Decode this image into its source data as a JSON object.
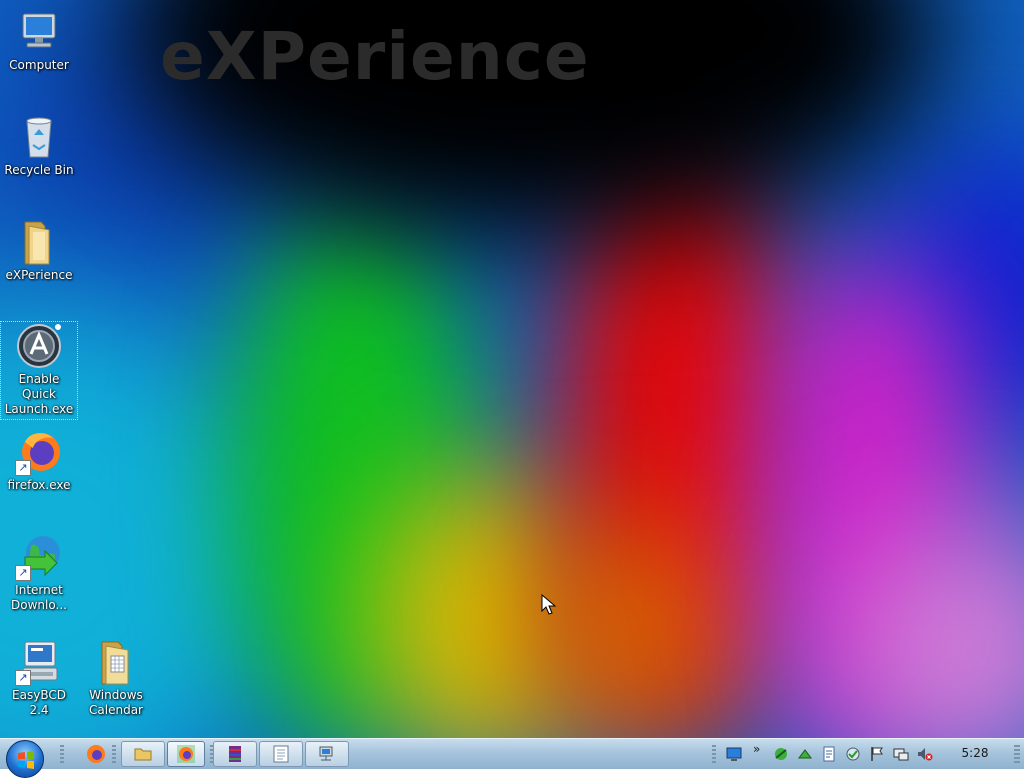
{
  "desktop": {
    "brand_text": "eXPerience",
    "icons": [
      {
        "name": "computer",
        "label": "Computer"
      },
      {
        "name": "recycle-bin",
        "label": "Recycle Bin"
      },
      {
        "name": "experience-folder",
        "label": "eXPerience"
      },
      {
        "name": "enable-quick-launch",
        "label": "Enable Quick Launch.exe",
        "selected": true
      },
      {
        "name": "firefox",
        "label": "firefox.exe"
      },
      {
        "name": "internet-download-manager",
        "label": "Internet Downlo..."
      },
      {
        "name": "easybcd",
        "label": "EasyBCD 2.4"
      },
      {
        "name": "windows-calendar",
        "label": "Windows Calendar"
      }
    ]
  },
  "taskbar": {
    "start_icon": "windows-orb-icon",
    "quick_launch": [
      {
        "name": "firefox-quicklaunch",
        "icon": "firefox-icon"
      },
      {
        "name": "explorer-quicklaunch",
        "icon": "folder-icon"
      }
    ],
    "buttons": [
      {
        "name": "firefox-task",
        "icon": "firefox-icon",
        "active": true
      },
      {
        "name": "winrar-task",
        "icon": "winrar-icon"
      },
      {
        "name": "notepad-task",
        "icon": "notepad-icon"
      },
      {
        "name": "network-task",
        "icon": "computer-network-icon"
      }
    ],
    "tray": {
      "expand_glyph": "»",
      "icons": [
        "show-desktop-icon",
        "network-green-icon",
        "network-green2-icon",
        "document-icon",
        "security-check-icon",
        "flag-icon",
        "connection-icon",
        "volume-muted-icon"
      ]
    },
    "clock": "5:28"
  },
  "colors": {
    "taskbar": "#a6c4dc",
    "brand": "#2b2b2b",
    "label": "#ffffff"
  }
}
